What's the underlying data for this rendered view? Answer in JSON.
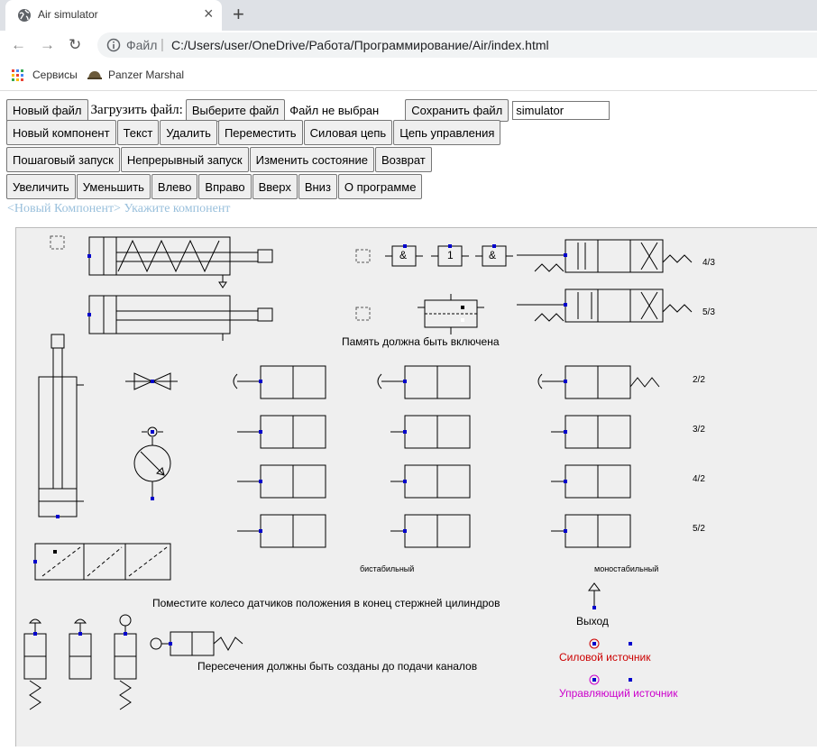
{
  "browser": {
    "tab_title": "Air simulator",
    "address": {
      "scheme_label": "Файл",
      "url": "C:/Users/user/OneDrive/Работа/Программирование/Air/index.html"
    },
    "bookmarks": [
      "Сервисы",
      "Panzer Marshal"
    ]
  },
  "toolbar": {
    "row1": {
      "new_file": "Новый файл",
      "load_label": "Загрузить файл:",
      "choose_file": "Выберите файл",
      "no_file": "Файл не выбран",
      "save_file": "Сохранить файл",
      "filename": "simulator"
    },
    "row2": [
      "Новый компонент",
      "Текст",
      "Удалить",
      "Переместить",
      "Силовая цепь",
      "Цепь управления"
    ],
    "row3": [
      "Пошаговый запуск",
      "Непрерывный запуск",
      "Изменить состояние",
      "Возврат"
    ],
    "row4": [
      "Увеличить",
      "Уменьшить",
      "Влево",
      "Вправо",
      "Вверх",
      "Вниз",
      "О программе"
    ]
  },
  "status": "<Новый Компонент> Укажите компонент",
  "canvas": {
    "notes": {
      "memory": "Память должна быть включена",
      "sensors": "Поместите колесо датчиков положения в конец стержней цилиндров",
      "crossings": "Пересечения должны быть созданы до подачи каналов",
      "bistable": "бистабильный",
      "monostable": "моностабильный",
      "output": "Выход",
      "power_source": "Силовой источник",
      "control_source": "Управляющий источник"
    },
    "valve_labels": [
      "4/3",
      "5/3",
      "2/2",
      "3/2",
      "4/2",
      "5/2"
    ],
    "logic": {
      "and": "&",
      "not": "1"
    },
    "colors": {
      "power": "#cc0000",
      "control": "#cc00cc",
      "port": "#0000cc"
    }
  }
}
